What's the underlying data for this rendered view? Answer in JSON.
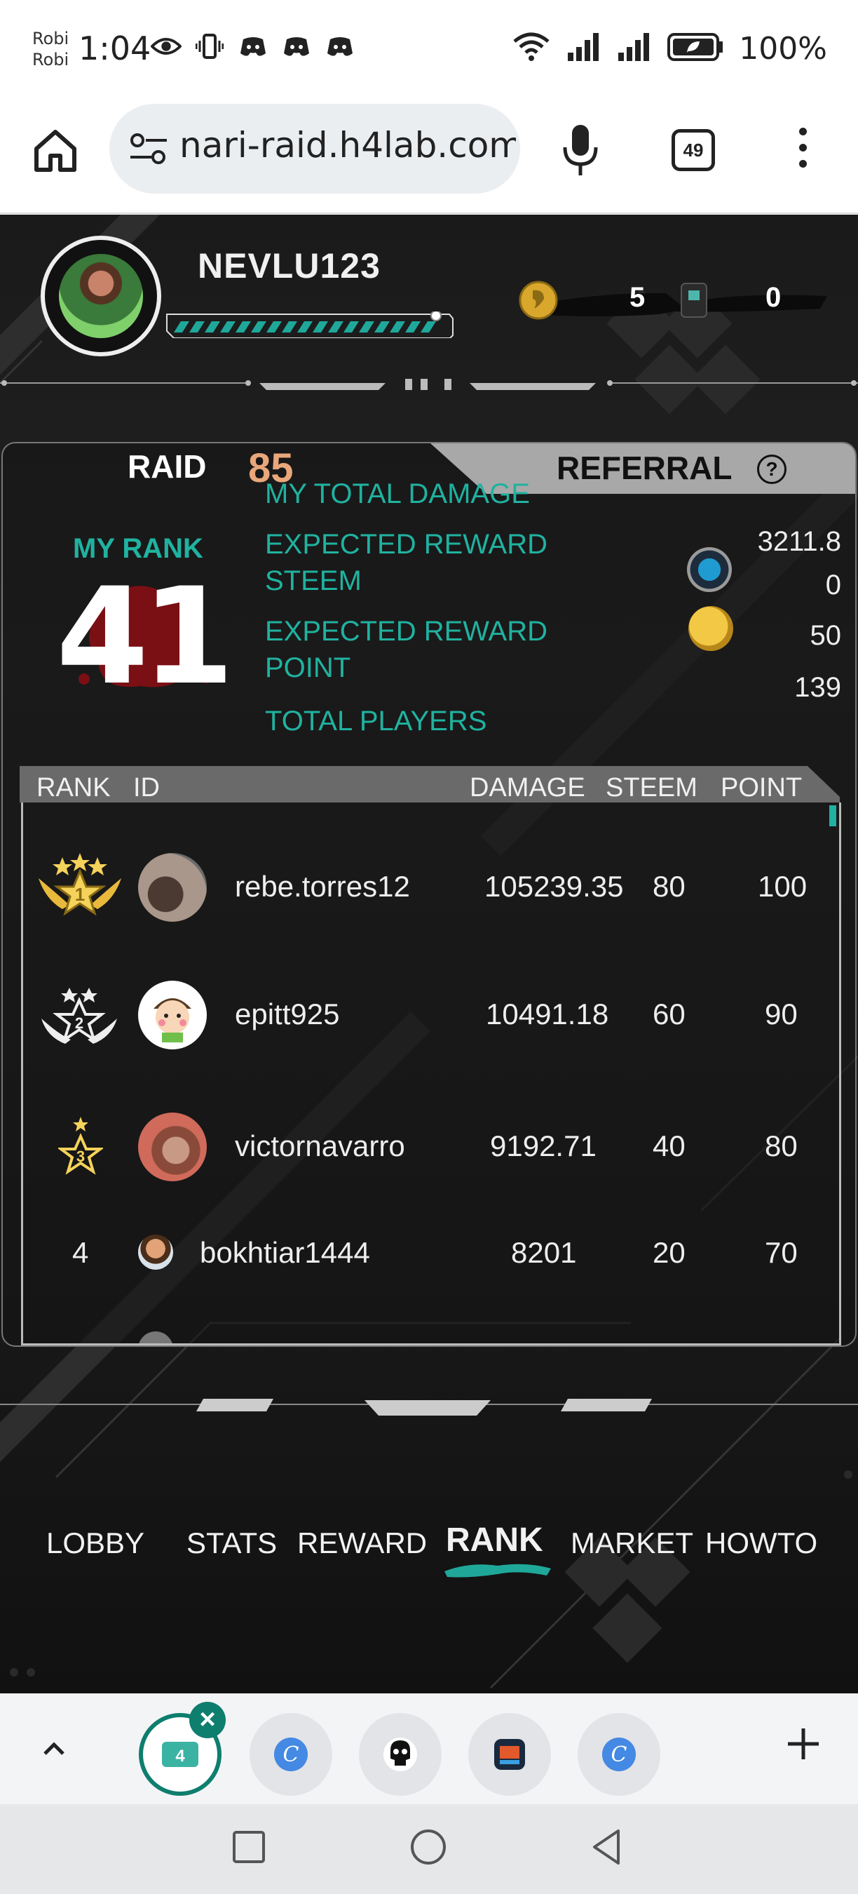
{
  "status_bar": {
    "carrier_line1": "Robi",
    "carrier_line2": "Robi",
    "time": "1:04",
    "battery": "100%",
    "icons": [
      "eye-icon",
      "vibrate-icon",
      "discord-icon",
      "discord-icon",
      "discord-icon",
      "wifi-icon",
      "signal-icon",
      "signal-icon",
      "battery-saver-icon"
    ]
  },
  "browser": {
    "url": "nari-raid.h4lab.com",
    "tab_count": "49"
  },
  "header": {
    "username": "NEVLU123",
    "xp_fraction": 0.95,
    "coins": "5",
    "tickets": "0"
  },
  "panel": {
    "tab_raid": "RAID",
    "tab_raid_number": "85",
    "tab_referral": "REFERRAL",
    "help": "?",
    "my_rank_label": "MY RANK",
    "my_rank": "41",
    "stats": {
      "total_damage_label": "MY TOTAL DAMAGE",
      "total_damage": "3211.8",
      "reward_steem_label_1": "EXPECTED REWARD",
      "reward_steem_label_2": "STEEM",
      "reward_steem": "0",
      "reward_point_label_1": "EXPECTED REWARD",
      "reward_point_label_2": "POINT",
      "reward_point": "50",
      "total_players_label": "TOTAL PLAYERS",
      "total_players": "139"
    }
  },
  "leaderboard": {
    "headers": {
      "rank": "RANK",
      "id": "ID",
      "damage": "DAMAGE",
      "steem": "STEEM",
      "point": "POINT"
    },
    "rows": [
      {
        "rank": "1",
        "id": "rebe.torres12",
        "damage": "105239.35",
        "steem": "80",
        "point": "100"
      },
      {
        "rank": "2",
        "id": "epitt925",
        "damage": "10491.18",
        "steem": "60",
        "point": "90"
      },
      {
        "rank": "3",
        "id": "victornavarro",
        "damage": "9192.71",
        "steem": "40",
        "point": "80"
      },
      {
        "rank": "4",
        "id": "bokhtiar1444",
        "damage": "8201",
        "steem": "20",
        "point": "70"
      }
    ]
  },
  "nav": {
    "items": [
      "LOBBY",
      "STATS",
      "REWARD",
      "RANK",
      "MARKET",
      "HOWTO"
    ],
    "active": "RANK"
  },
  "colors": {
    "accent_teal": "#20b2a0",
    "raid_number": "#e9a77a",
    "rank_blood": "#7a0f14"
  }
}
